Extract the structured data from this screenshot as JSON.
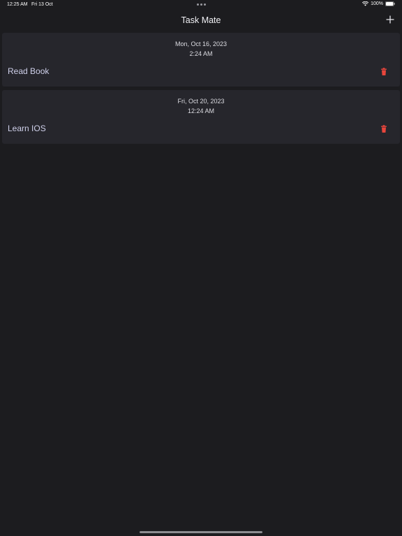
{
  "status_bar": {
    "time": "12:25 AM",
    "date": "Fri 13 Oct",
    "battery": "100%",
    "icons": [
      "wifi-icon",
      "battery-icon"
    ]
  },
  "nav": {
    "title": "Task Mate",
    "add_icon": "plus-icon"
  },
  "tasks": [
    {
      "date": "Mon, Oct 16, 2023",
      "time": "2:24 AM",
      "title": "Read Book",
      "delete_icon": "trash-icon"
    },
    {
      "date": "Fri, Oct 20, 2023",
      "time": "12:24 AM",
      "title": "Learn IOS",
      "delete_icon": "trash-icon"
    }
  ],
  "colors": {
    "background": "#1c1c1f",
    "card": "#26262c",
    "delete": "#e8453c",
    "task_title": "#cfd0ea"
  }
}
